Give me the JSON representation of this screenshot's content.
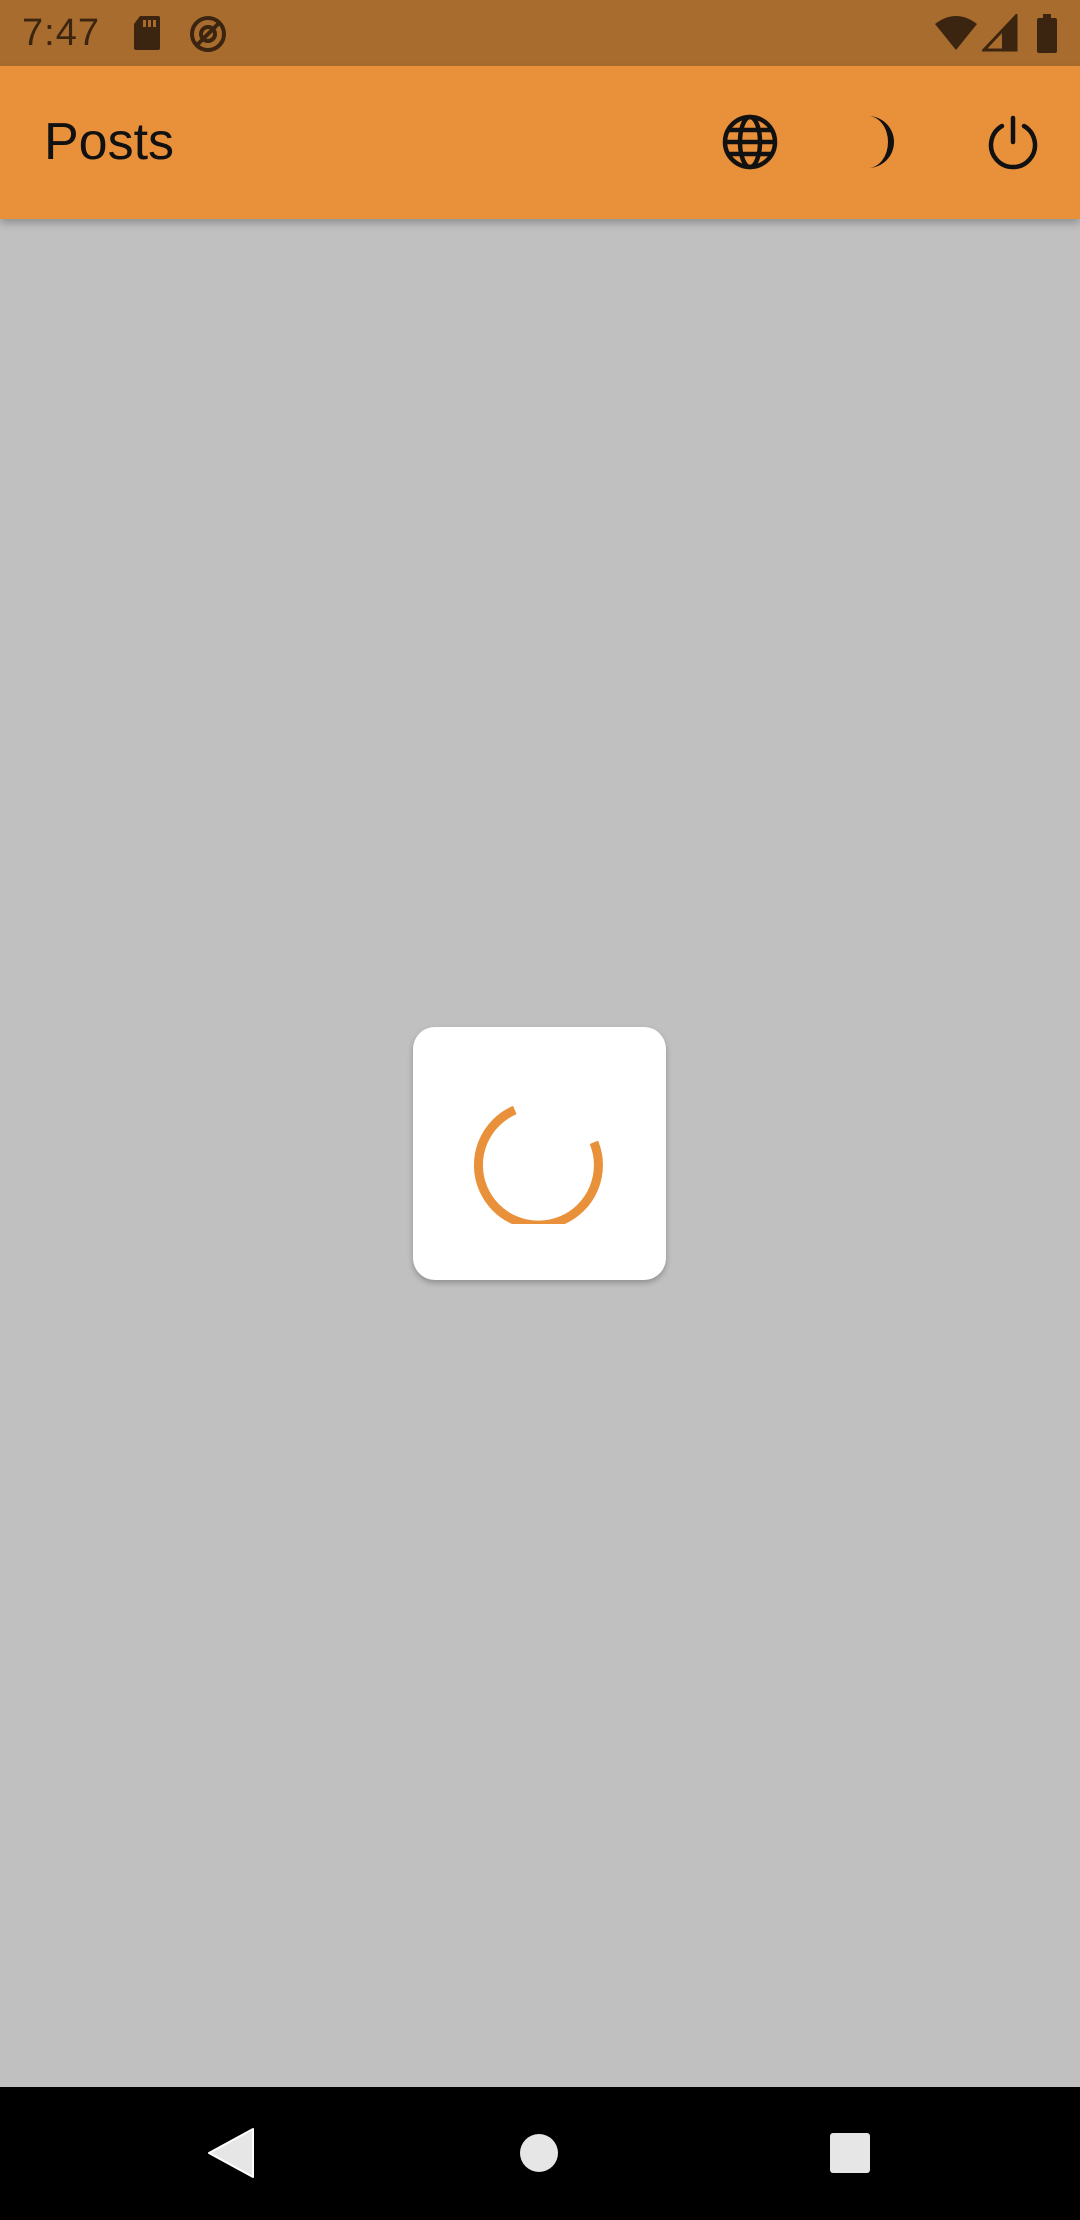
{
  "status_bar": {
    "time": "7:47",
    "icons": [
      "sd-card-icon",
      "do-not-disturb-icon",
      "wifi-icon",
      "signal-icon",
      "battery-icon"
    ]
  },
  "app_bar": {
    "title": "Posts",
    "actions": [
      "globe-icon",
      "moon-icon",
      "power-icon"
    ],
    "background_color": "#e9913a"
  },
  "loading": {
    "spinner_color": "#e9913a"
  },
  "nav_bar": {
    "buttons": [
      "back-icon",
      "home-icon",
      "recents-icon"
    ]
  }
}
